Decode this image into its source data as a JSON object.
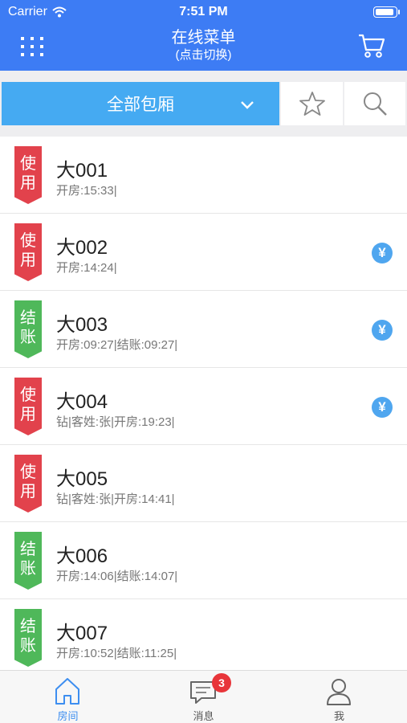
{
  "status_bar": {
    "carrier": "Carrier",
    "time": "7:51 PM"
  },
  "nav": {
    "title": "在线菜单",
    "subtitle": "(点击切换)",
    "left_icon": "grid-icon",
    "right_icon": "cart-icon"
  },
  "filter": {
    "selected": "全部包厢",
    "favorite_icon": "star-icon",
    "search_icon": "search-icon"
  },
  "rooms": [
    {
      "status": "使用",
      "status_type": "use",
      "name": "大001",
      "info": "开房:15:33|",
      "paid": false
    },
    {
      "status": "使用",
      "status_type": "use",
      "name": "大002",
      "info": "开房:14:24|",
      "paid": true
    },
    {
      "status": "结账",
      "status_type": "checkout",
      "name": "大003",
      "info": "开房:09:27|结账:09:27|",
      "paid": true
    },
    {
      "status": "使用",
      "status_type": "use",
      "name": "大004",
      "info": "钻|客姓:张|开房:19:23|",
      "paid": true
    },
    {
      "status": "使用",
      "status_type": "use",
      "name": "大005",
      "info": "钻|客姓:张|开房:14:41|",
      "paid": false
    },
    {
      "status": "结账",
      "status_type": "checkout",
      "name": "大006",
      "info": "开房:14:06|结账:14:07|",
      "paid": false
    },
    {
      "status": "结账",
      "status_type": "checkout",
      "name": "大007",
      "info": "开房:10:52|结账:11:25|",
      "paid": false
    }
  ],
  "pay_symbol": "¥",
  "tabs": [
    {
      "label": "房间",
      "icon": "home-icon",
      "active": true
    },
    {
      "label": "消息",
      "icon": "message-icon",
      "badge": "3"
    },
    {
      "label": "我",
      "icon": "user-icon"
    }
  ],
  "colors": {
    "primary": "#3d7cf4",
    "filter": "#45aaf2",
    "use": "#e2424c",
    "checkout": "#4fb85a",
    "pay": "#4fa6ef",
    "badge": "#e8353a"
  }
}
